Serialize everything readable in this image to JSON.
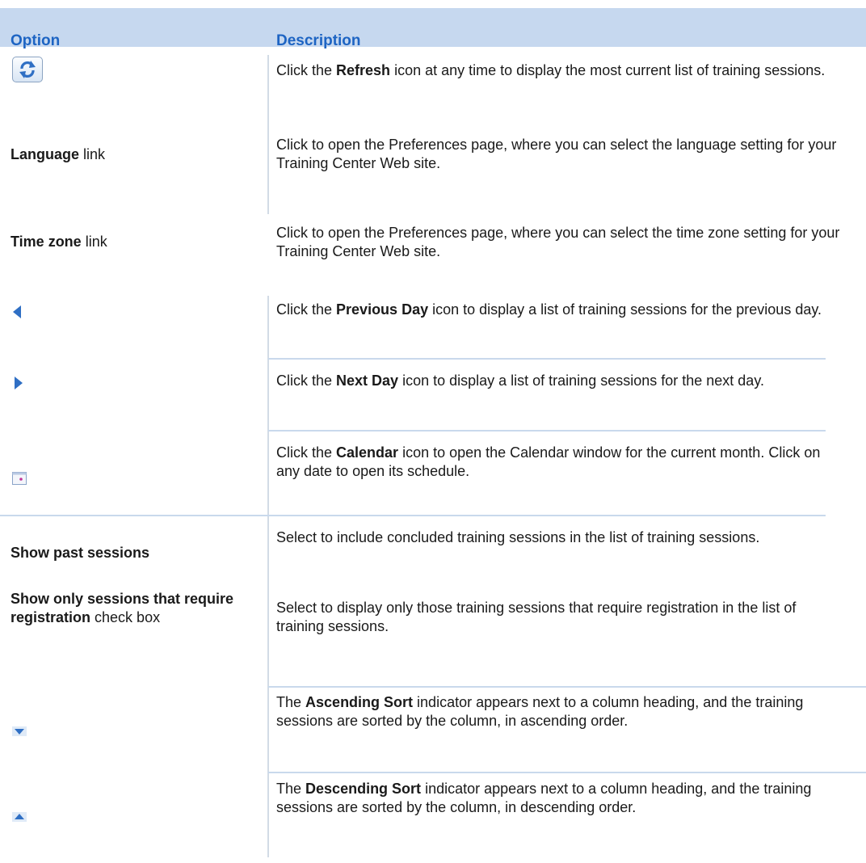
{
  "header": {
    "option": "Option",
    "description": "Description"
  },
  "icons": {
    "refresh": "refresh-icon",
    "previous_day": "arrow-left-icon",
    "next_day": "arrow-right-icon",
    "calendar": "calendar-icon",
    "ascending": "sort-down-icon",
    "descending": "sort-up-icon"
  },
  "colors": {
    "header_band": "#c6d8ef",
    "header_text": "#1d64c3",
    "icon_blue": "#2f6fc4"
  },
  "rows": [
    {
      "desc": {
        "pre": "Click the ",
        "bold": "Refresh",
        "post": " icon at any time to display the most current list of training sessions."
      }
    },
    {
      "option": {
        "bold": "Language",
        "post": " link"
      },
      "desc": {
        "text": "Click to open the Preferences page, where you can select the language setting for your Training Center Web site."
      }
    },
    {
      "option": {
        "bold": "Time zone",
        "post": " link"
      },
      "desc": {
        "text": "Click to open the Preferences page, where you can select the time zone setting for your Training Center Web site."
      }
    },
    {
      "desc": {
        "pre": "Click the ",
        "bold": "Previous Day",
        "post": " icon to display a list of training sessions for the previous day."
      }
    },
    {
      "desc": {
        "pre": "Click the ",
        "bold": "Next Day",
        "post": " icon to display a list of training sessions for the next day."
      }
    },
    {
      "desc": {
        "pre": "Click the ",
        "bold": "Calendar",
        "post": " icon to open the Calendar window for the current month. Click on any date to open its schedule."
      }
    },
    {
      "option": {
        "bold": "Show past sessions"
      },
      "desc": {
        "text": "Select to include concluded training sessions in the list of training sessions."
      }
    },
    {
      "option": {
        "bold": "Show only sessions that require registration",
        "post": " check box"
      },
      "desc": {
        "text": "Select to display only those training sessions that require registration in the list of training sessions."
      }
    },
    {
      "desc": {
        "pre": "The ",
        "bold": "Ascending Sort",
        "post": " indicator appears next to a column heading, and the training sessions are sorted by the column, in ascending order."
      }
    },
    {
      "desc": {
        "pre": "The ",
        "bold": "Descending Sort",
        "post": " indicator appears next to a column heading, and the training sessions are sorted by the column, in descending order."
      }
    }
  ]
}
